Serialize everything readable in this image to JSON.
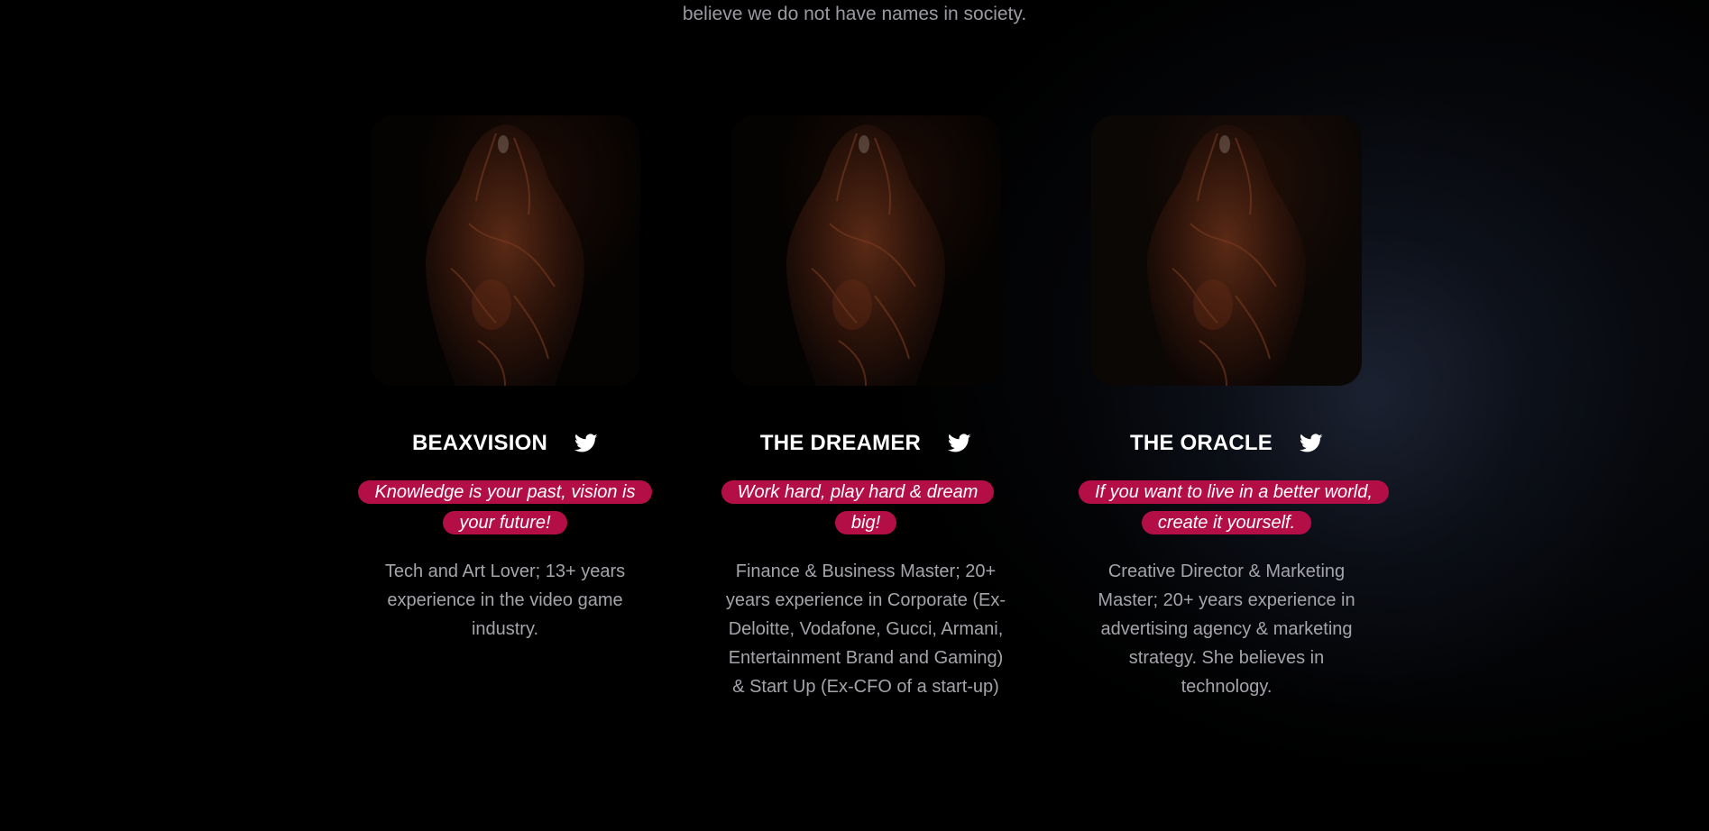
{
  "intro": {
    "text": "believe we do not have names in society."
  },
  "team": [
    {
      "name": "BEAXVISION",
      "quote": "Knowledge is your past, vision is your future!",
      "bio": "Tech and Art Lover; 13+ years experience in the video game industry.",
      "icon": "twitter-icon"
    },
    {
      "name": "THE DREAMER",
      "quote": "Work hard, play hard & dream big!",
      "bio": "Finance & Business Master; 20+ years experience in Corporate (Ex-Deloitte, Vodafone, Gucci, Armani, Entertainment Brand and Gaming) & Start Up (Ex-CFO of a start-up)",
      "icon": "twitter-icon"
    },
    {
      "name": "THE ORACLE",
      "quote": "If you want to live in a better world, create it yourself.",
      "bio": "Creative Director & Marketing Master; 20+ years experience in advertising agency & marketing strategy. She believes in technology.",
      "icon": "twitter-icon"
    }
  ],
  "colors": {
    "background": "#000000",
    "quote_highlight": "#b30e45",
    "name_text": "#ffffff",
    "body_text": "#a4a4aa"
  }
}
